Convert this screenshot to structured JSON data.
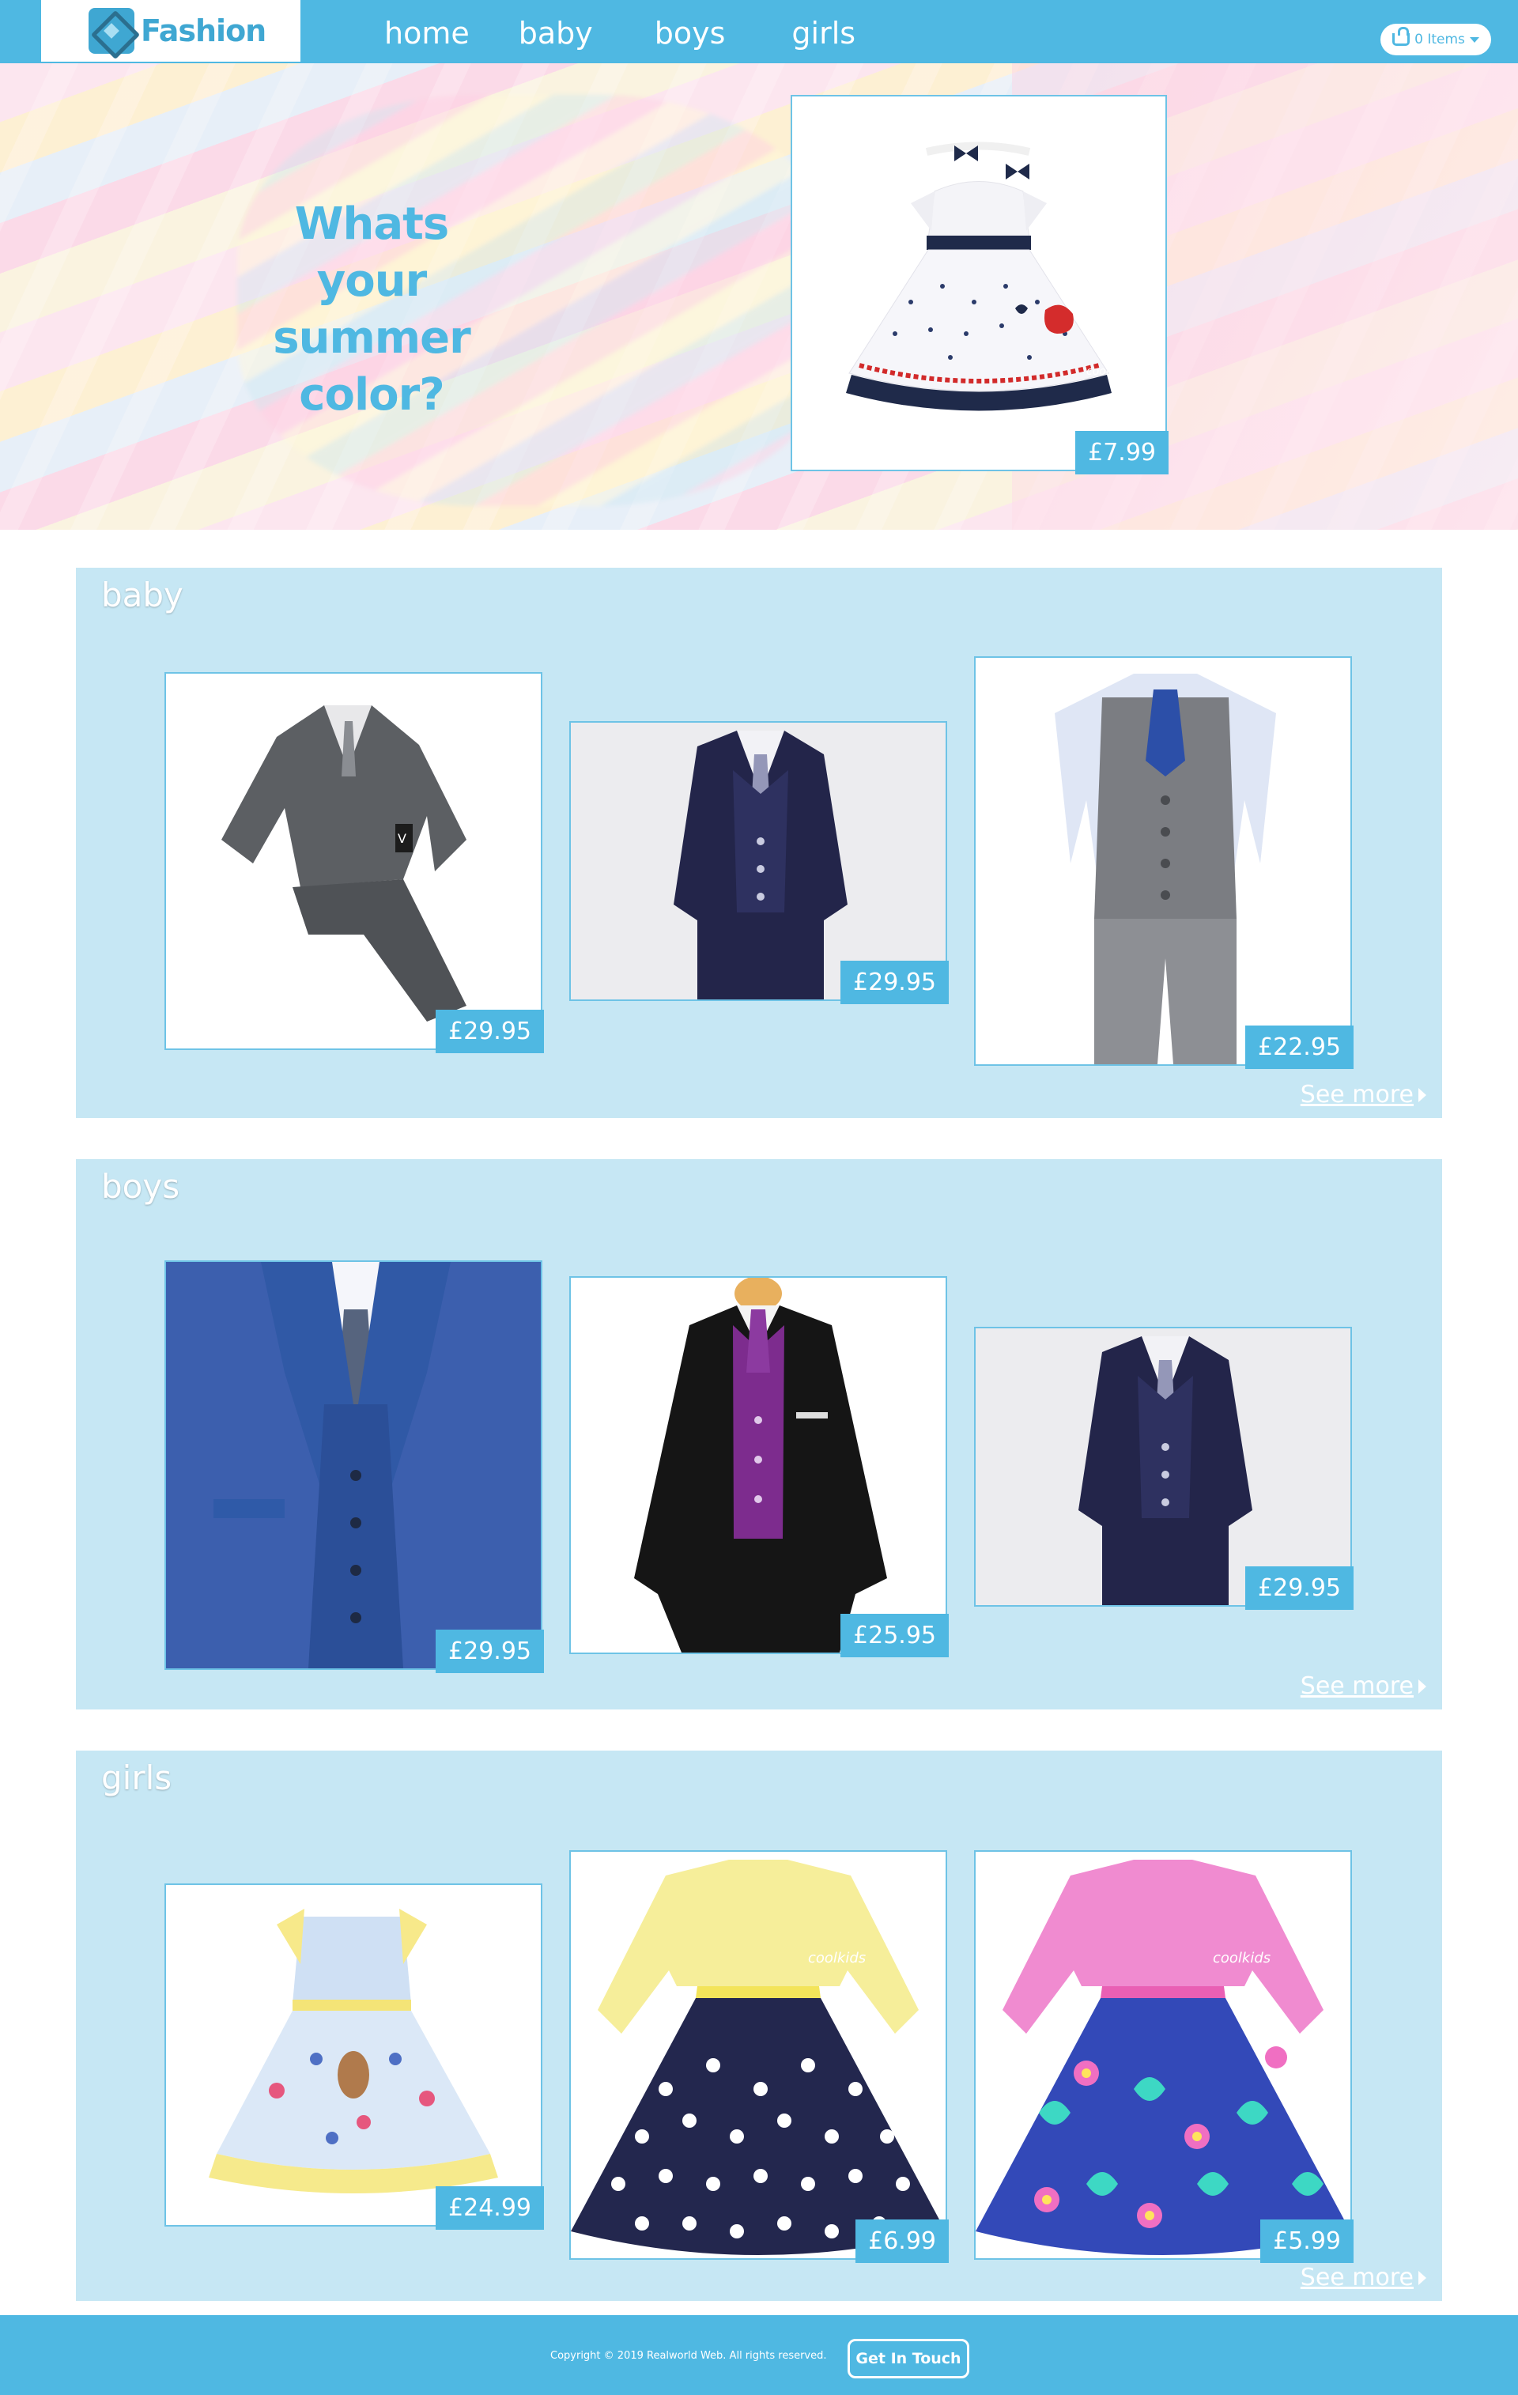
{
  "header": {
    "logo_text": "Fashion",
    "nav": [
      {
        "label": "home"
      },
      {
        "label": "baby"
      },
      {
        "label": "boys"
      },
      {
        "label": "girls"
      }
    ],
    "cart_label": "0 Items",
    "cart_icon": "basket-icon"
  },
  "hero": {
    "title": "Whats your summer color?",
    "featured": {
      "product": "baby dress with bows",
      "price": "£7.99"
    }
  },
  "sections": [
    {
      "title": "baby",
      "see_more": "See more",
      "products": [
        {
          "name": "grey suit",
          "price": "£29.95"
        },
        {
          "name": "navy suit",
          "price": "£29.95"
        },
        {
          "name": "grey waistcoat set",
          "price": "£22.95"
        }
      ]
    },
    {
      "title": "boys",
      "see_more": "See more",
      "products": [
        {
          "name": "blue suit",
          "price": "£29.95"
        },
        {
          "name": "black suit with purple waistcoat",
          "price": "£25.95"
        },
        {
          "name": "navy suit",
          "price": "£29.95"
        }
      ]
    },
    {
      "title": "girls",
      "see_more": "See more",
      "products": [
        {
          "name": "yellow princess dress",
          "price": "£24.99"
        },
        {
          "name": "navy polka dot dress",
          "price": "£6.99"
        },
        {
          "name": "pink floral dress",
          "price": "£5.99"
        }
      ]
    }
  ],
  "footer": {
    "copyright": "Copyright © 2019 Realworld Web. All rights reserved.",
    "contact_button": "Get In Touch"
  },
  "colors": {
    "brand": "#4fb8e2",
    "section_bg": "#c6e7f4"
  }
}
